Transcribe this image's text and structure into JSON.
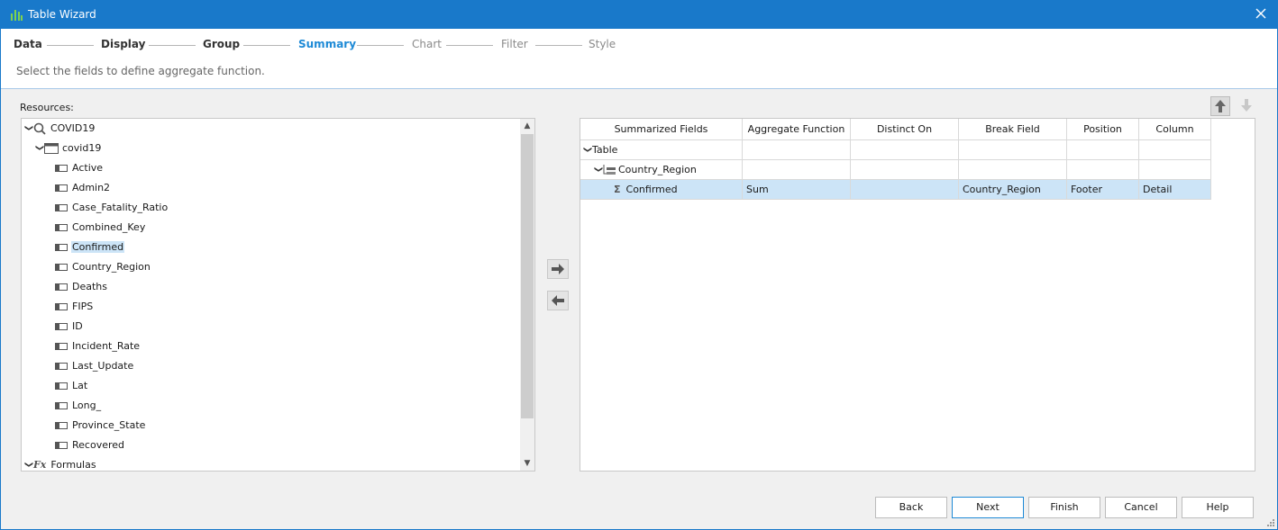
{
  "window": {
    "title": "Table Wizard"
  },
  "steps": [
    {
      "label": "Data",
      "state": "done"
    },
    {
      "label": "Display",
      "state": "done"
    },
    {
      "label": "Group",
      "state": "done"
    },
    {
      "label": "Summary",
      "state": "active"
    },
    {
      "label": "Chart",
      "state": "future"
    },
    {
      "label": "Filter",
      "state": "future"
    },
    {
      "label": "Style",
      "state": "future"
    }
  ],
  "subtitle": "Select the fields to define aggregate function.",
  "resources": {
    "label": "Resources:",
    "datasource": "COVID19",
    "table": "covid19",
    "fields": [
      "Active",
      "Admin2",
      "Case_Fatality_Ratio",
      "Combined_Key",
      "Confirmed",
      "Country_Region",
      "Deaths",
      "FIPS",
      "ID",
      "Incident_Rate",
      "Last_Update",
      "Lat",
      "Long_",
      "Province_State",
      "Recovered"
    ],
    "selected_field": "Confirmed",
    "formulas": "Formulas"
  },
  "summary_grid": {
    "headers": [
      "Summarized Fields",
      "Aggregate Function",
      "Distinct On",
      "Break Field",
      "Position",
      "Column"
    ],
    "table_node": "Table",
    "group_node": "Country_Region",
    "row": {
      "field": "Confirmed",
      "aggregate": "Sum",
      "distinct_on": "",
      "break_field": "Country_Region",
      "position": "Footer",
      "column": "Detail"
    }
  },
  "buttons": {
    "back": "Back",
    "next": "Next",
    "finish": "Finish",
    "cancel": "Cancel",
    "help": "Help"
  },
  "colors": {
    "accent": "#1979ca",
    "active_step": "#1e8ad6",
    "selection": "#cce4f7"
  }
}
